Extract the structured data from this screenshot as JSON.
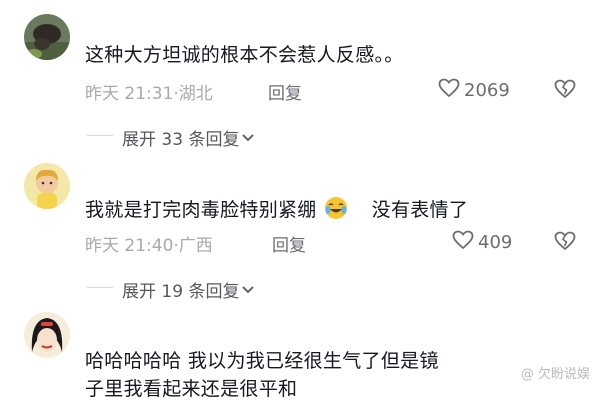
{
  "comments": [
    {
      "text": "这种大方坦诚的根本不会惹人反感。。",
      "time_location": "昨天 21:31·湖北",
      "reply_label": "回复",
      "likes": "2069",
      "expand_label": "展开 33 条回复"
    },
    {
      "text_part1": "我就是打完肉毒脸特别紧绷",
      "text_part2": "没有表情了",
      "time_location": "昨天 21:40·广西",
      "reply_label": "回复",
      "likes": "409",
      "expand_label": "展开 19 条回复"
    },
    {
      "text_line1": "哈哈哈哈哈 我以为我已经很生气了但是镜",
      "text_line2": "子里我看起来还是很平和"
    }
  ],
  "watermark": "@ 欠盼说娱",
  "icons": {
    "like": "heart-outline-icon",
    "dislike": "broken-heart-icon",
    "expand": "chevron-down-icon",
    "emoji": "crying-laughing-emoji"
  }
}
